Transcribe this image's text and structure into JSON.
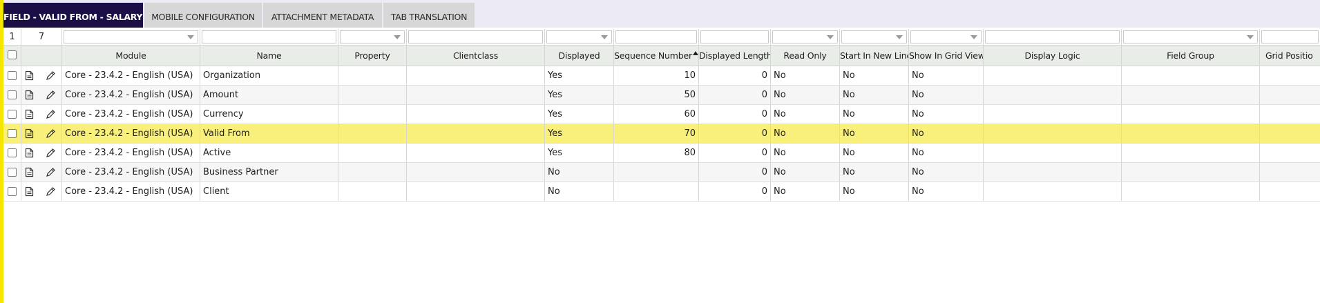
{
  "tabs": [
    {
      "label": "FIELD - VALID FROM - SALARY ...",
      "active": true
    },
    {
      "label": "MOBILE CONFIGURATION",
      "active": false
    },
    {
      "label": "ATTACHMENT METADATA",
      "active": false
    },
    {
      "label": "TAB TRANSLATION",
      "active": false
    }
  ],
  "grid": {
    "selected_count": "1",
    "total_count": "7",
    "columns": [
      "Module",
      "Name",
      "Property",
      "Clientclass",
      "Displayed",
      "Sequence Number",
      "Displayed Length",
      "Read Only",
      "Start In New Line",
      "Show In Grid View",
      "Display Logic",
      "Field Group",
      "Grid Positio"
    ],
    "sorted_column": "Sequence Number",
    "sort_direction": "ascending",
    "rows": [
      {
        "module": "Core - 23.4.2 - English (USA)",
        "name": "Organization",
        "property": "",
        "clientclass": "",
        "displayed": "Yes",
        "sequence": "10",
        "length": "0",
        "read_only": "No",
        "new_line": "No",
        "grid_view": "No",
        "selected": false
      },
      {
        "module": "Core - 23.4.2 - English (USA)",
        "name": "Amount",
        "property": "",
        "clientclass": "",
        "displayed": "Yes",
        "sequence": "50",
        "length": "0",
        "read_only": "No",
        "new_line": "No",
        "grid_view": "No",
        "selected": false
      },
      {
        "module": "Core - 23.4.2 - English (USA)",
        "name": "Currency",
        "property": "",
        "clientclass": "",
        "displayed": "Yes",
        "sequence": "60",
        "length": "0",
        "read_only": "No",
        "new_line": "No",
        "grid_view": "No",
        "selected": false
      },
      {
        "module": "Core - 23.4.2 - English (USA)",
        "name": "Valid From",
        "property": "",
        "clientclass": "",
        "displayed": "Yes",
        "sequence": "70",
        "length": "0",
        "read_only": "No",
        "new_line": "No",
        "grid_view": "No",
        "selected": true
      },
      {
        "module": "Core - 23.4.2 - English (USA)",
        "name": "Active",
        "property": "",
        "clientclass": "",
        "displayed": "Yes",
        "sequence": "80",
        "length": "0",
        "read_only": "No",
        "new_line": "No",
        "grid_view": "No",
        "selected": false
      },
      {
        "module": "Core - 23.4.2 - English (USA)",
        "name": "Business Partner",
        "property": "",
        "clientclass": "",
        "displayed": "No",
        "sequence": "",
        "length": "0",
        "read_only": "No",
        "new_line": "No",
        "grid_view": "No",
        "selected": false
      },
      {
        "module": "Core - 23.4.2 - English (USA)",
        "name": "Client",
        "property": "",
        "clientclass": "",
        "displayed": "No",
        "sequence": "",
        "length": "0",
        "read_only": "No",
        "new_line": "No",
        "grid_view": "No",
        "selected": false
      }
    ]
  },
  "colors": {
    "active_tab": "#1c0f47",
    "selected_row": "#f8f07a",
    "left_accent": "#f5e600",
    "header_bg": "#e9ede7"
  }
}
